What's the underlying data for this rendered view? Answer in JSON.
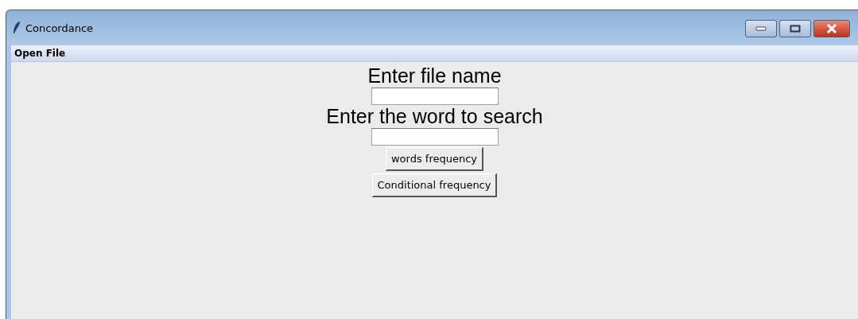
{
  "window": {
    "title": "Concordance"
  },
  "menu": [
    "Open File"
  ],
  "form": [
    {
      "kind": "label",
      "text": "Enter file name"
    },
    {
      "kind": "field"
    },
    {
      "kind": "label",
      "text": "Enter the word to search"
    },
    {
      "kind": "field"
    },
    {
      "kind": "button",
      "text": "words frequency"
    },
    {
      "kind": "button",
      "text": "Conditional frequency"
    }
  ]
}
